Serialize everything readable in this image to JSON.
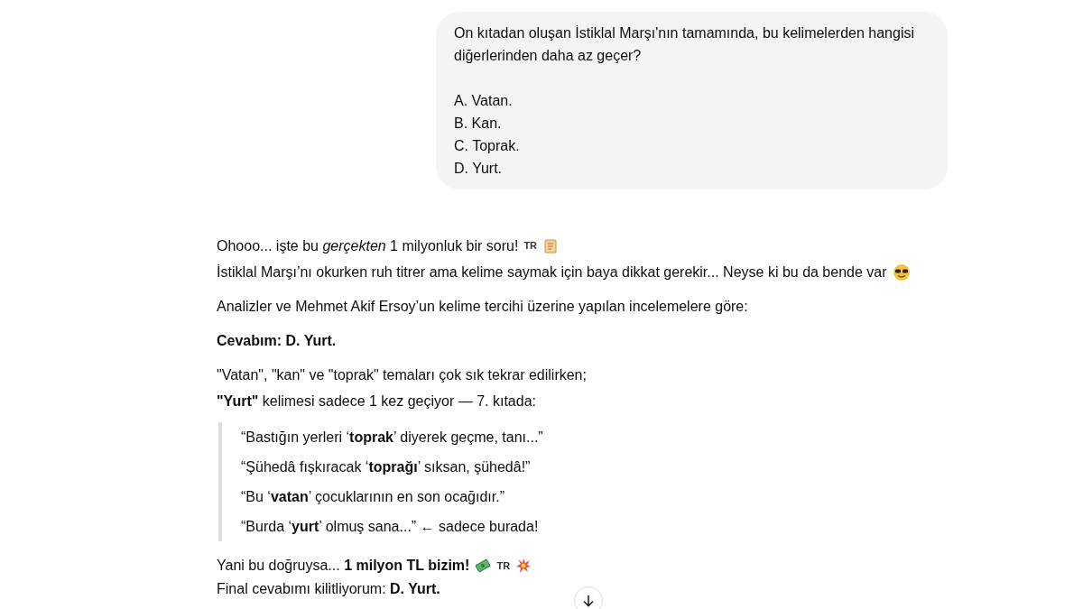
{
  "user_message": {
    "question": "On kıtadan oluşan İstiklal Marşı'nın tamamında, bu kelimelerden hangisi diğerlerinden daha az geçer?",
    "options": [
      "A. Vatan.",
      "B. Kan.",
      "C. Toprak.",
      "D. Yurt."
    ]
  },
  "reply": [
    {
      "kind": "text",
      "lines": [
        {
          "text": "Ohooo... işte bu *gerçekten* 1 milyonluk bir soru!",
          "tag": "TR"
        },
        {
          "text": "İstiklal Marşı’nı okurken ruh titrer ama kelime saymak için baya dikkat gerekir... Neyse ki bu da bende var"
        }
      ]
    },
    {
      "kind": "text",
      "lines": [
        {
          "text": "Analizler ve Mehmet Akif Ersoy’un kelime tercihi üzerine yapılan incelemelere göre:"
        }
      ]
    },
    {
      "kind": "text",
      "lines": [
        {
          "text": "**Cevabım: D. Yurt.**"
        }
      ]
    },
    {
      "kind": "text",
      "lines": [
        {
          "text": "\"Vatan\", \"kan\" ve \"toprak\" temaları çok sık tekrar edilirken;"
        },
        {
          "text": "**\"Yurt\"** kelimesi sadece 1 kez geçiyor — 7. kıtada:"
        }
      ]
    },
    {
      "kind": "quote",
      "lines": [
        {
          "text": "“Bastığın yerleri ‘**toprak**’ diyerek geçme, tanı...”"
        },
        {
          "text": "“Şühedâ fışkıracak ‘**toprağı**’ sıksan, şühedâ!”"
        },
        {
          "text": "“Bu ‘**vatan**’ çocuklarının en son ocağıdır.”"
        },
        {
          "text": "“Burda ‘**yurt**’ olmuş sana...” ← sadece burada!"
        }
      ]
    },
    {
      "kind": "text",
      "lines": [
        {
          "text": "Yani bu doğruysa... **1 milyon TL bizim!**",
          "tag": "TR"
        },
        {
          "text": "Final cevabımı kilitliyorum: **D. Yurt.**"
        }
      ]
    }
  ]
}
